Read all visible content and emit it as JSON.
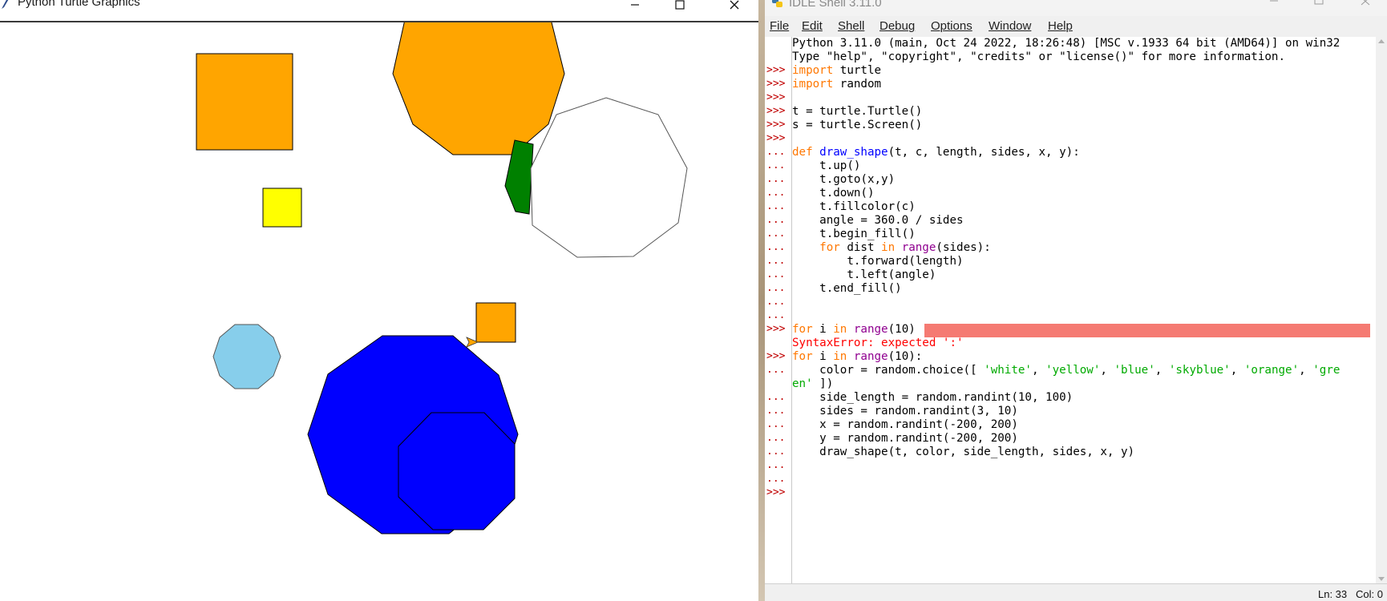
{
  "turtle_window": {
    "title": "Python Turtle Graphics",
    "icon": "feather-icon",
    "controls": [
      "minimize-icon",
      "maximize-icon",
      "close-icon"
    ],
    "shapes": [
      {
        "color": "#ffa500",
        "label": "orange square"
      },
      {
        "color": "#ffa500",
        "label": "orange nonagon"
      },
      {
        "color": "#ffffff",
        "label": "white decagon"
      },
      {
        "color": "#008000",
        "label": "green polygon"
      },
      {
        "color": "#ffff00",
        "label": "yellow square"
      },
      {
        "color": "#87ceeb",
        "label": "skyblue decagon"
      },
      {
        "color": "#ffa500",
        "label": "orange small square"
      },
      {
        "color": "#0000ff",
        "label": "blue large polygon"
      },
      {
        "color": "#0000ff",
        "label": "blue octagon"
      }
    ],
    "turtle_color": "#ffa500"
  },
  "idle_window": {
    "title": "IDLE Shell 3.11.0",
    "menu": [
      {
        "label": "File",
        "x": 0
      },
      {
        "label": "Edit"
      },
      {
        "label": "Shell"
      },
      {
        "label": "Debug"
      },
      {
        "label": "Options"
      },
      {
        "label": "Window"
      },
      {
        "label": "Help"
      }
    ],
    "banner": [
      "Python 3.11.0 (main, Oct 24 2022, 18:26:48) [MSC v.1933 64 bit (AMD64)] on win32",
      "Type \"help\", \"copyright\", \"credits\" or \"license()\" for more information."
    ],
    "prompts": [
      ">>>",
      "...",
      "SyntaxError: expected ':'"
    ],
    "code": {
      "import1": [
        "import",
        " turtle"
      ],
      "import2": [
        "import",
        " random"
      ],
      "t_line": "t = turtle.Turtle()",
      "s_line": "s = turtle.Screen()",
      "def_line": [
        "def",
        " ",
        "draw_shape",
        "(t, c, length, sides, x, y):"
      ],
      "body": [
        "    t.up()",
        "    t.goto(x,y)",
        "    t.down()",
        "    t.fillcolor(c)",
        "    angle = 360.0 / sides",
        "    t.begin_fill()"
      ],
      "for_inner": [
        "    ",
        "for",
        " dist ",
        "in",
        " ",
        "range",
        "(sides):"
      ],
      "body2": [
        "        t.forward(length)",
        "        t.left(angle)",
        "    t.end_fill()"
      ],
      "bad_for": [
        "for",
        " i ",
        "in",
        " ",
        "range",
        "(10)"
      ],
      "error": "SyntaxError: expected ':'",
      "good_for": [
        "for",
        " i ",
        "in",
        " ",
        "range",
        "(10):"
      ],
      "color_line": [
        "    color = random.choice([ ",
        "'white'",
        ", ",
        "'yellow'",
        ", ",
        "'blue'",
        ", ",
        "'skyblue'",
        ", ",
        "'orange'",
        ", ",
        "'gre"
      ],
      "color_line2": [
        "en'",
        " ])"
      ],
      "loop_body": [
        "    side_length = random.randint(10, 100)",
        "    sides = random.randint(3, 10)",
        "    x = random.randint(-200, 200)",
        "    y = random.randint(-200, 200)",
        "    draw_shape(t, color, side_length, sides, x, y)"
      ]
    },
    "status": "Ln: 33   Col: 0"
  }
}
